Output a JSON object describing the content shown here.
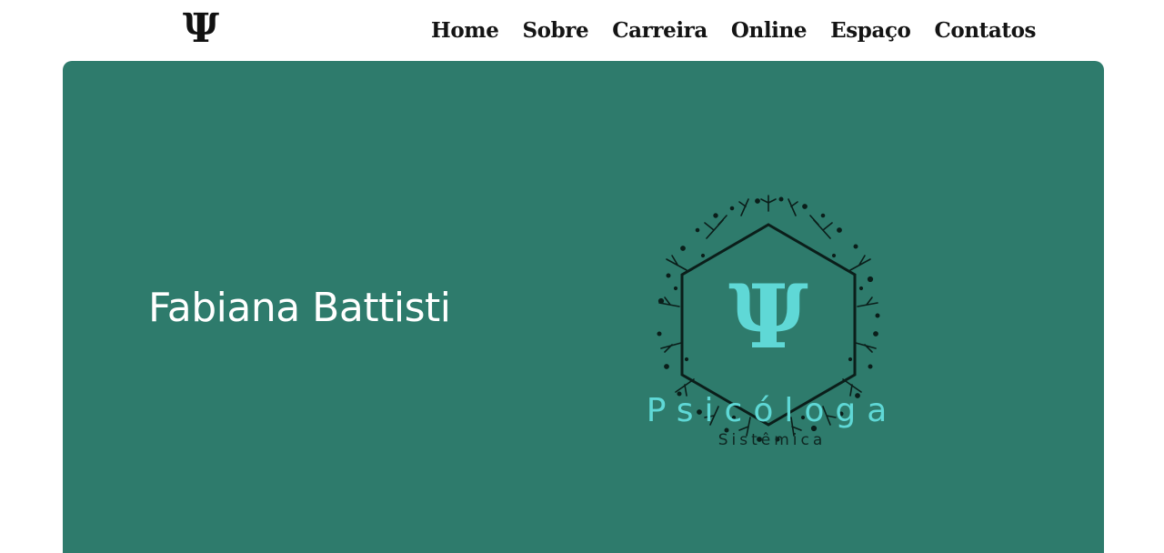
{
  "header": {
    "logo_symbol": "Ψ",
    "nav": [
      {
        "label": "Home"
      },
      {
        "label": "Sobre"
      },
      {
        "label": "Carreira"
      },
      {
        "label": "Online"
      },
      {
        "label": "Espaço"
      },
      {
        "label": "Contatos"
      }
    ]
  },
  "hero": {
    "name": "Fabiana Battisti",
    "logo": {
      "symbol": "Ψ",
      "title": "Psicóloga",
      "subtitle": "Sistêmica",
      "icon": "psi-hexagon-floral-icon"
    }
  },
  "colors": {
    "hero_background": "#2e7b6c",
    "logo_accent": "#5fd8d6",
    "nav_text": "#141414"
  }
}
